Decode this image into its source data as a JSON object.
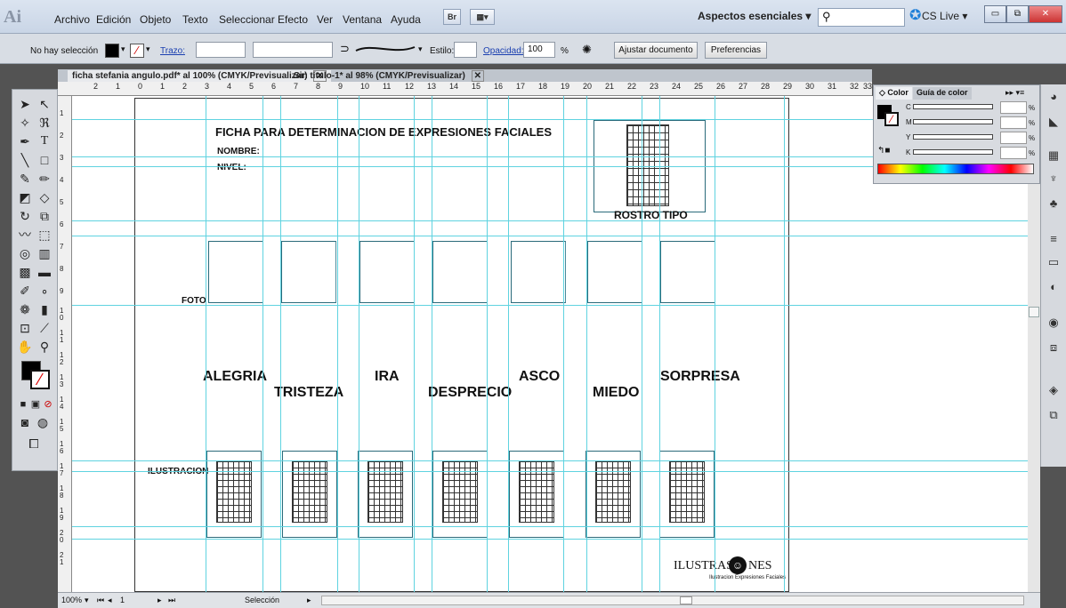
{
  "app": {
    "logo": "Ai"
  },
  "menu": [
    "Archivo",
    "Edición",
    "Objeto",
    "Texto",
    "Seleccionar",
    "Efecto",
    "Ver",
    "Ventana",
    "Ayuda"
  ],
  "menubar": {
    "bridge_label": "Br",
    "workspace": "Aspectos esenciales ▾",
    "search_placeholder": "",
    "cslive": "CS Live ▾"
  },
  "window_controls": {
    "minimize": "▭",
    "restore": "⧉",
    "close": "✕"
  },
  "control": {
    "selection": "No hay selección",
    "stroke_label": "Trazo:",
    "style_label": "Estilo:",
    "opacity_label": "Opacidad:",
    "opacity_value": "100",
    "opacity_unit": "%",
    "fit_button": "Ajustar documento",
    "prefs_button": "Preferencias"
  },
  "tabs": [
    {
      "label": "ficha stefania angulo.pdf* al 100% (CMYK/Previsualizar)",
      "close": "✕"
    },
    {
      "label": "Sin título-1* al 98% (CMYK/Previsualizar)",
      "close": "✕"
    }
  ],
  "ruler_h": [
    "2",
    "1",
    "0",
    "1",
    "2",
    "3",
    "4",
    "5",
    "6",
    "7",
    "8",
    "9",
    "10",
    "11",
    "12",
    "13",
    "14",
    "15",
    "16",
    "17",
    "18",
    "19",
    "20",
    "21",
    "22",
    "23",
    "24",
    "25",
    "26",
    "27",
    "28",
    "29",
    "30",
    "31",
    "32",
    "33"
  ],
  "ruler_v": [
    "1",
    "2",
    "3",
    "4",
    "5",
    "6",
    "7",
    "8",
    "9",
    "1 0",
    "1 1",
    "1 2",
    "1 3",
    "1 4",
    "1 5",
    "1 6",
    "1 7",
    "1 8",
    "1 9",
    "2 0",
    "2 1"
  ],
  "document": {
    "title": "FICHA PARA DETERMINACION DE EXPRESIONES FACIALES",
    "name_label": "NOMBRE:",
    "level_label": "NIVEL:",
    "face_type": "ROSTRO TIPO",
    "photo_label": "FOTO",
    "illustration_label": "ILUSTRACION",
    "logo_text": "ILUSTRAS",
    "logo_suffix": "NES",
    "logo_tagline": "Ilustracion Expresiones Faciales",
    "emotions": [
      "ALEGRIA",
      "TRISTEZA",
      "IRA",
      "DESPRECIO",
      "ASCO",
      "MIEDO",
      "SORPRESA"
    ]
  },
  "color_panel": {
    "tab_color": "◇ Color",
    "tab_guide": "Guía de color",
    "channels": [
      "C",
      "M",
      "Y",
      "K"
    ],
    "percent": "%"
  },
  "status": {
    "zoom": "100%",
    "page": "1",
    "tool": "Selección"
  },
  "colors": {
    "guide": "#5fd3e0",
    "artboard_border": "#333333"
  }
}
